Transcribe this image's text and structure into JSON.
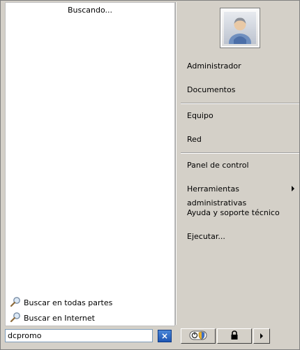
{
  "results": {
    "status": "Buscando...",
    "links": [
      {
        "label": "Buscar en todas partes"
      },
      {
        "label": "Buscar en Internet"
      }
    ]
  },
  "right_pane": {
    "items": [
      {
        "label": "Administrador"
      },
      {
        "label": "Documentos"
      },
      {
        "label": "Equipo"
      },
      {
        "label": "Red"
      },
      {
        "label": "Panel de control"
      },
      {
        "label": "Herramientas administrativas"
      },
      {
        "label": "Ayuda y soporte técnico"
      },
      {
        "label": "Ejecutar..."
      }
    ]
  },
  "search": {
    "value": "dcpromo",
    "clear_glyph": "×"
  },
  "colors": {
    "background": "#d4d0c8",
    "clear_button": "#2a63c3"
  }
}
